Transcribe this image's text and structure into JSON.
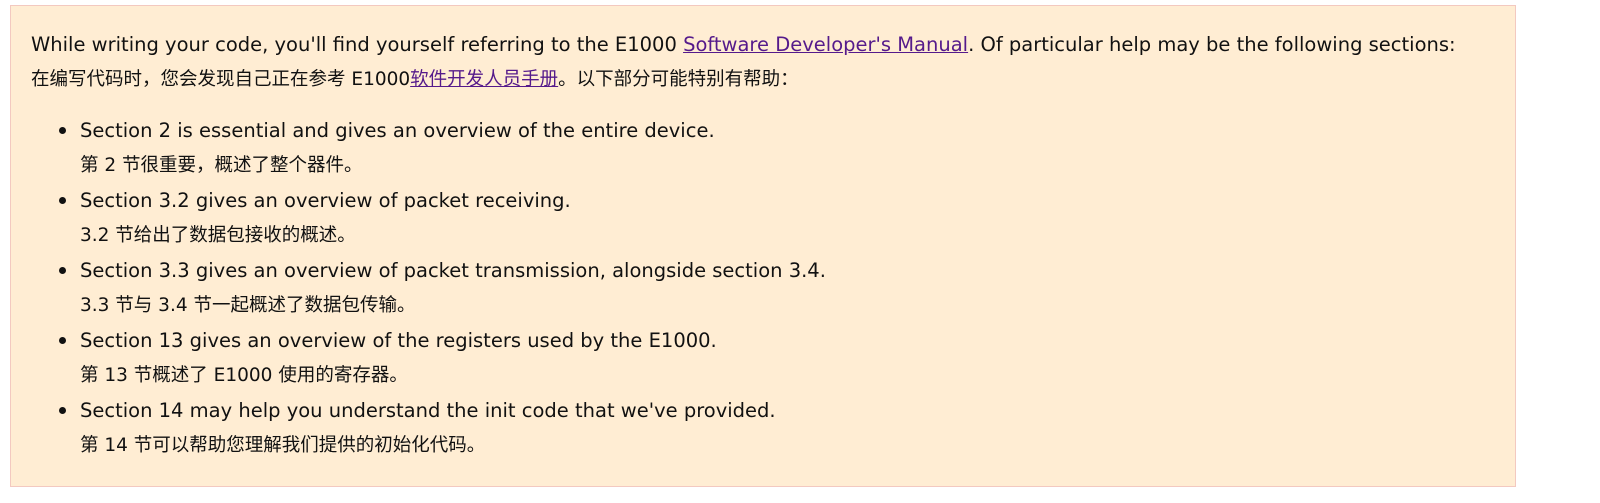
{
  "intro": {
    "en_before": "While writing your code, you'll find yourself referring to the E1000 ",
    "en_link": "Software Developer's Manual",
    "en_after": ". Of particular help may be the following sections:",
    "zh_before": "在编写代码时，您会发现自己正在参考 E1000",
    "zh_link": "软件开发人员手册",
    "zh_after": "。以下部分可能特别有帮助："
  },
  "sections": [
    {
      "en": "Section 2 is essential and gives an overview of the entire device.",
      "zh": "第 2 节很重要，概述了整个器件。"
    },
    {
      "en": "Section 3.2 gives an overview of packet receiving.",
      "zh": "3.2 节给出了数据包接收的概述。"
    },
    {
      "en": "Section 3.3 gives an overview of packet transmission, alongside section 3.4.",
      "zh": "3.3 节与 3.4 节一起概述了数据包传输。"
    },
    {
      "en": "Section 13 gives an overview of the registers used by the E1000.",
      "zh": "第 13 节概述了 E1000 使用的寄存器。"
    },
    {
      "en": "Section 14 may help you understand the init code that we've provided.",
      "zh": "第 14 节可以帮助您理解我们提供的初始化代码。"
    }
  ],
  "colors": {
    "background": "#ffedd3",
    "border": "#f3c9c0",
    "link": "#551a8b"
  }
}
